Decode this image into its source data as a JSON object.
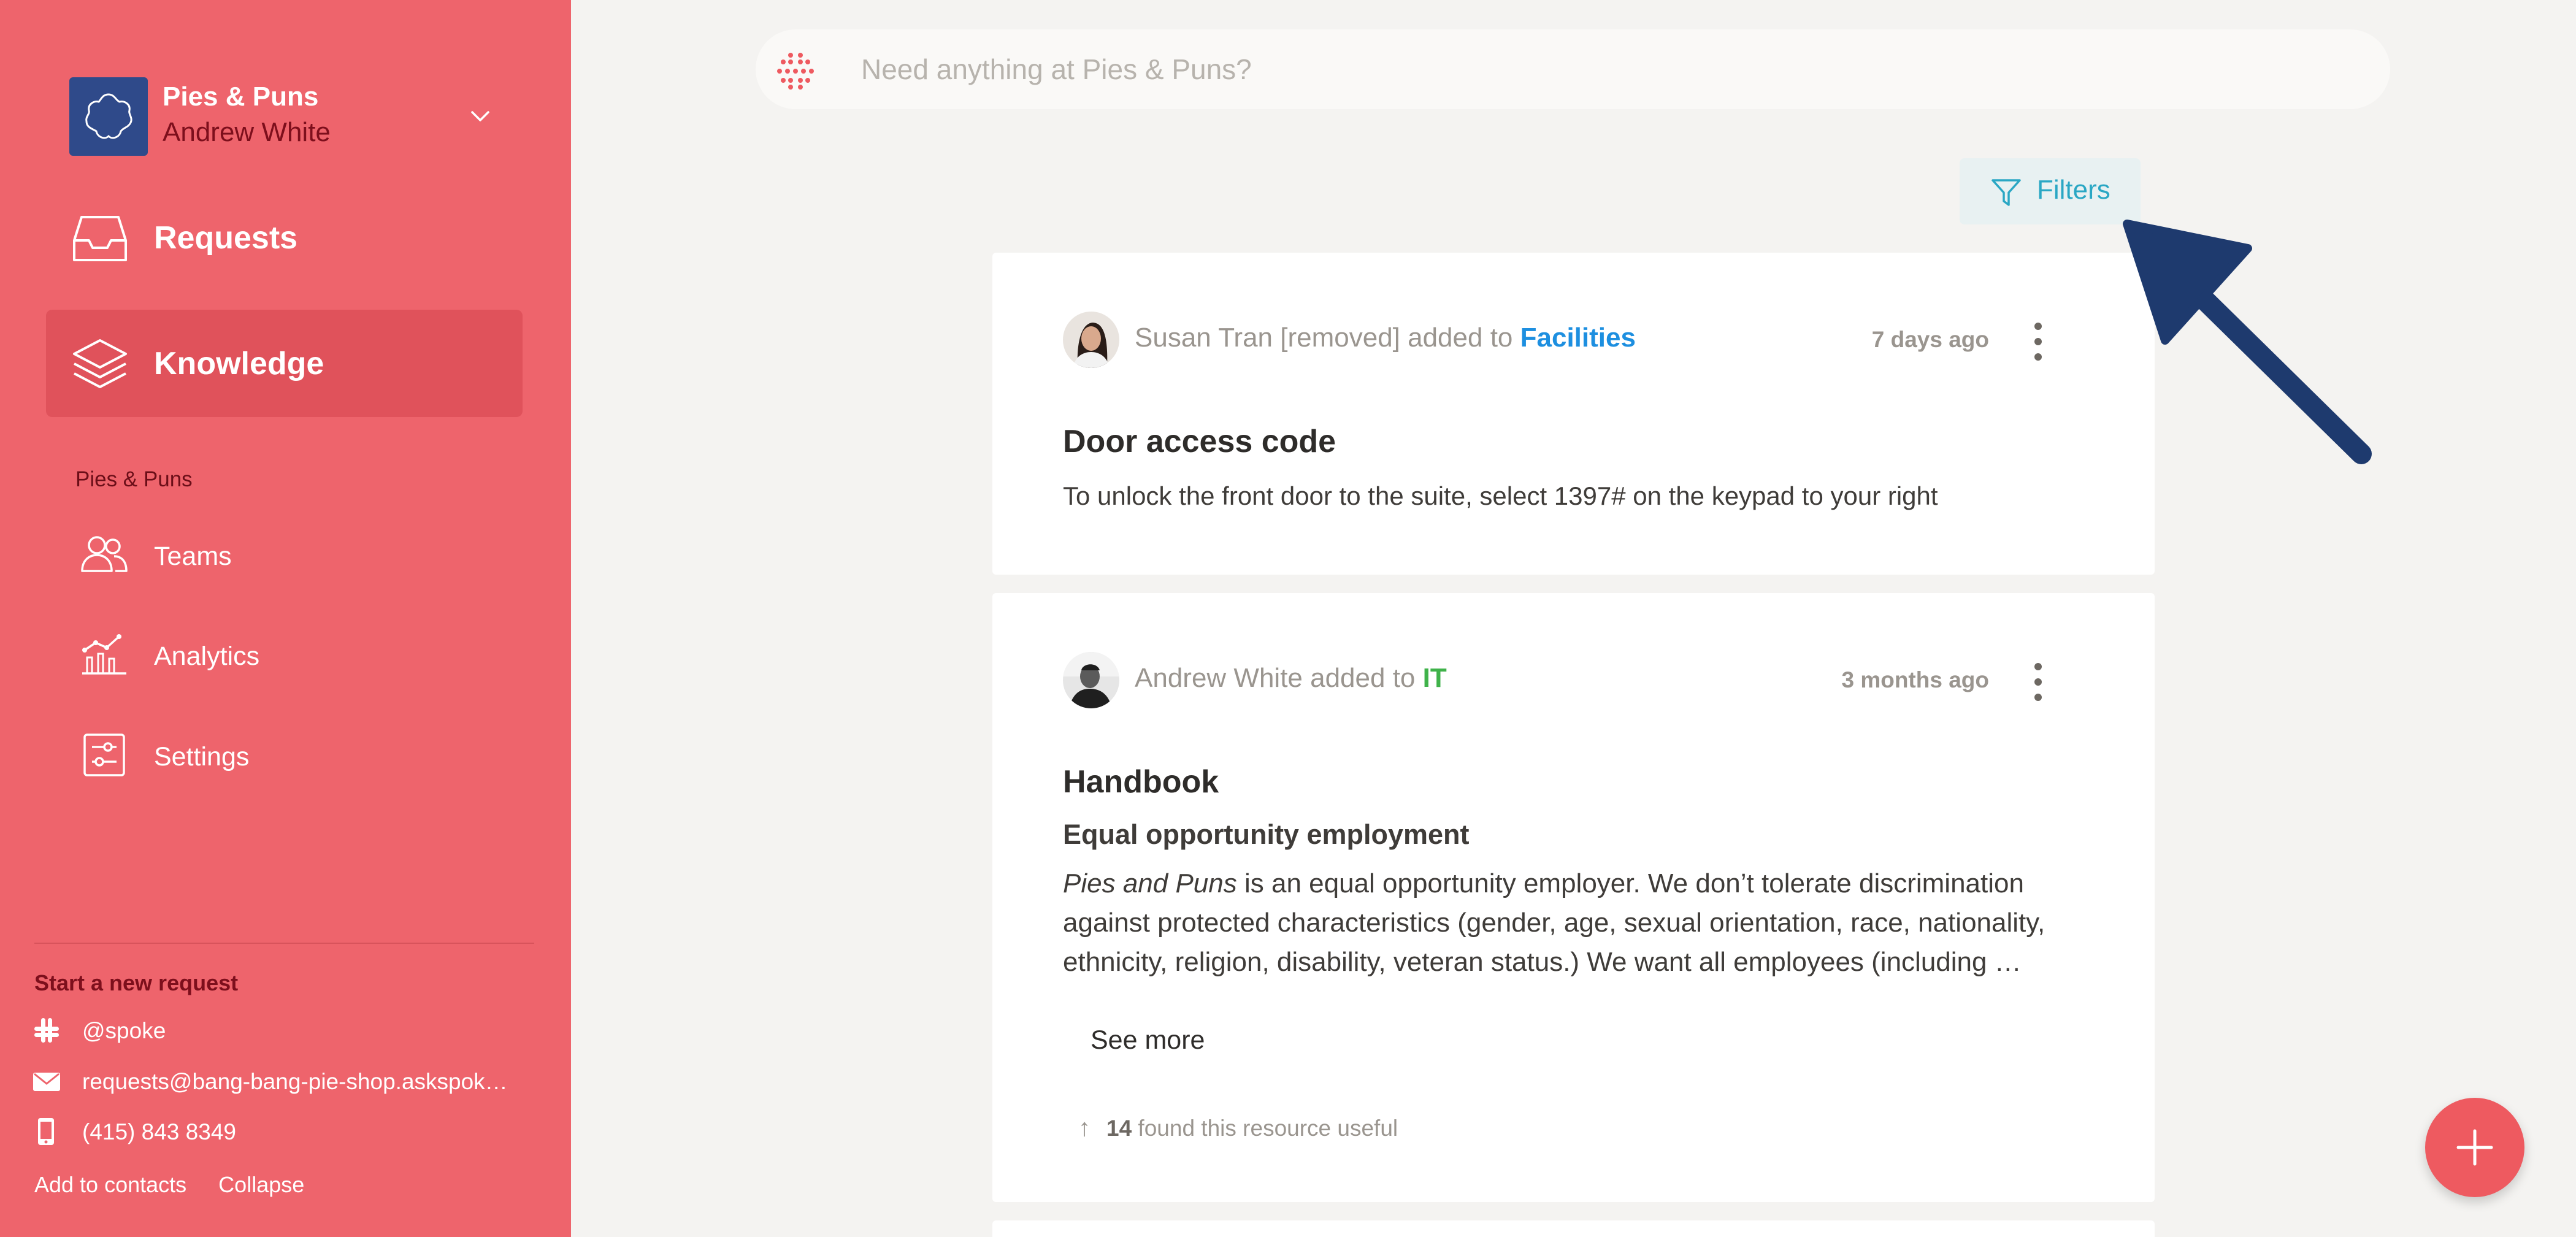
{
  "sidebar": {
    "org": {
      "name": "Pies & Puns",
      "user": "Andrew White"
    },
    "nav": {
      "requests": "Requests",
      "knowledge": "Knowledge"
    },
    "section_label": "Pies & Puns",
    "sub": {
      "teams": "Teams",
      "analytics": "Analytics",
      "settings": "Settings"
    },
    "new_request": {
      "heading": "Start a new request",
      "slack": "@spoke",
      "email": "requests@bang-bang-pie-shop.askspok…",
      "phone": "(415) 843 8349"
    },
    "footer": {
      "add_contacts": "Add to contacts",
      "collapse": "Collapse"
    }
  },
  "search": {
    "placeholder": "Need anything at Pies & Puns?"
  },
  "filters": {
    "label": "Filters"
  },
  "cards": [
    {
      "author": "Susan Tran [removed]",
      "action": " added to ",
      "team": "Facilities",
      "time": "7 days ago",
      "title": "Door access code",
      "body": "To unlock the front door to the suite, select 1397# on the keypad to your right"
    },
    {
      "author": "Andrew White",
      "action": " added to ",
      "team": "IT",
      "time": "3 months ago",
      "title": "Handbook",
      "subheading": "Equal opportunity employment",
      "para_italic": "Pies and Puns",
      "para_line1": " is an equal opportunity employer. We don’t tolerate discrimination",
      "para_line2": "against protected characteristics (gender, age, sexual orientation, race, nationality,",
      "para_line3": "ethnicity, religion, disability, veteran status.) We want all employees (including …",
      "see_more": "See more",
      "useful_count": "14",
      "useful_text": " found this resource useful"
    }
  ],
  "colors": {
    "sidebar": "#ee646c",
    "accent_teal": "#2aa7c4",
    "link_blue": "#1d8fe0",
    "link_green": "#3fb24a",
    "annotation_arrow": "#1e3a6e",
    "fab": "#ee5a60"
  },
  "icons": {
    "requests": "inbox-tray-icon",
    "knowledge": "layers-icon",
    "teams": "people-icon",
    "analytics": "chart-icon",
    "settings": "sliders-icon",
    "filters": "funnel-icon",
    "fab": "plus-icon"
  }
}
